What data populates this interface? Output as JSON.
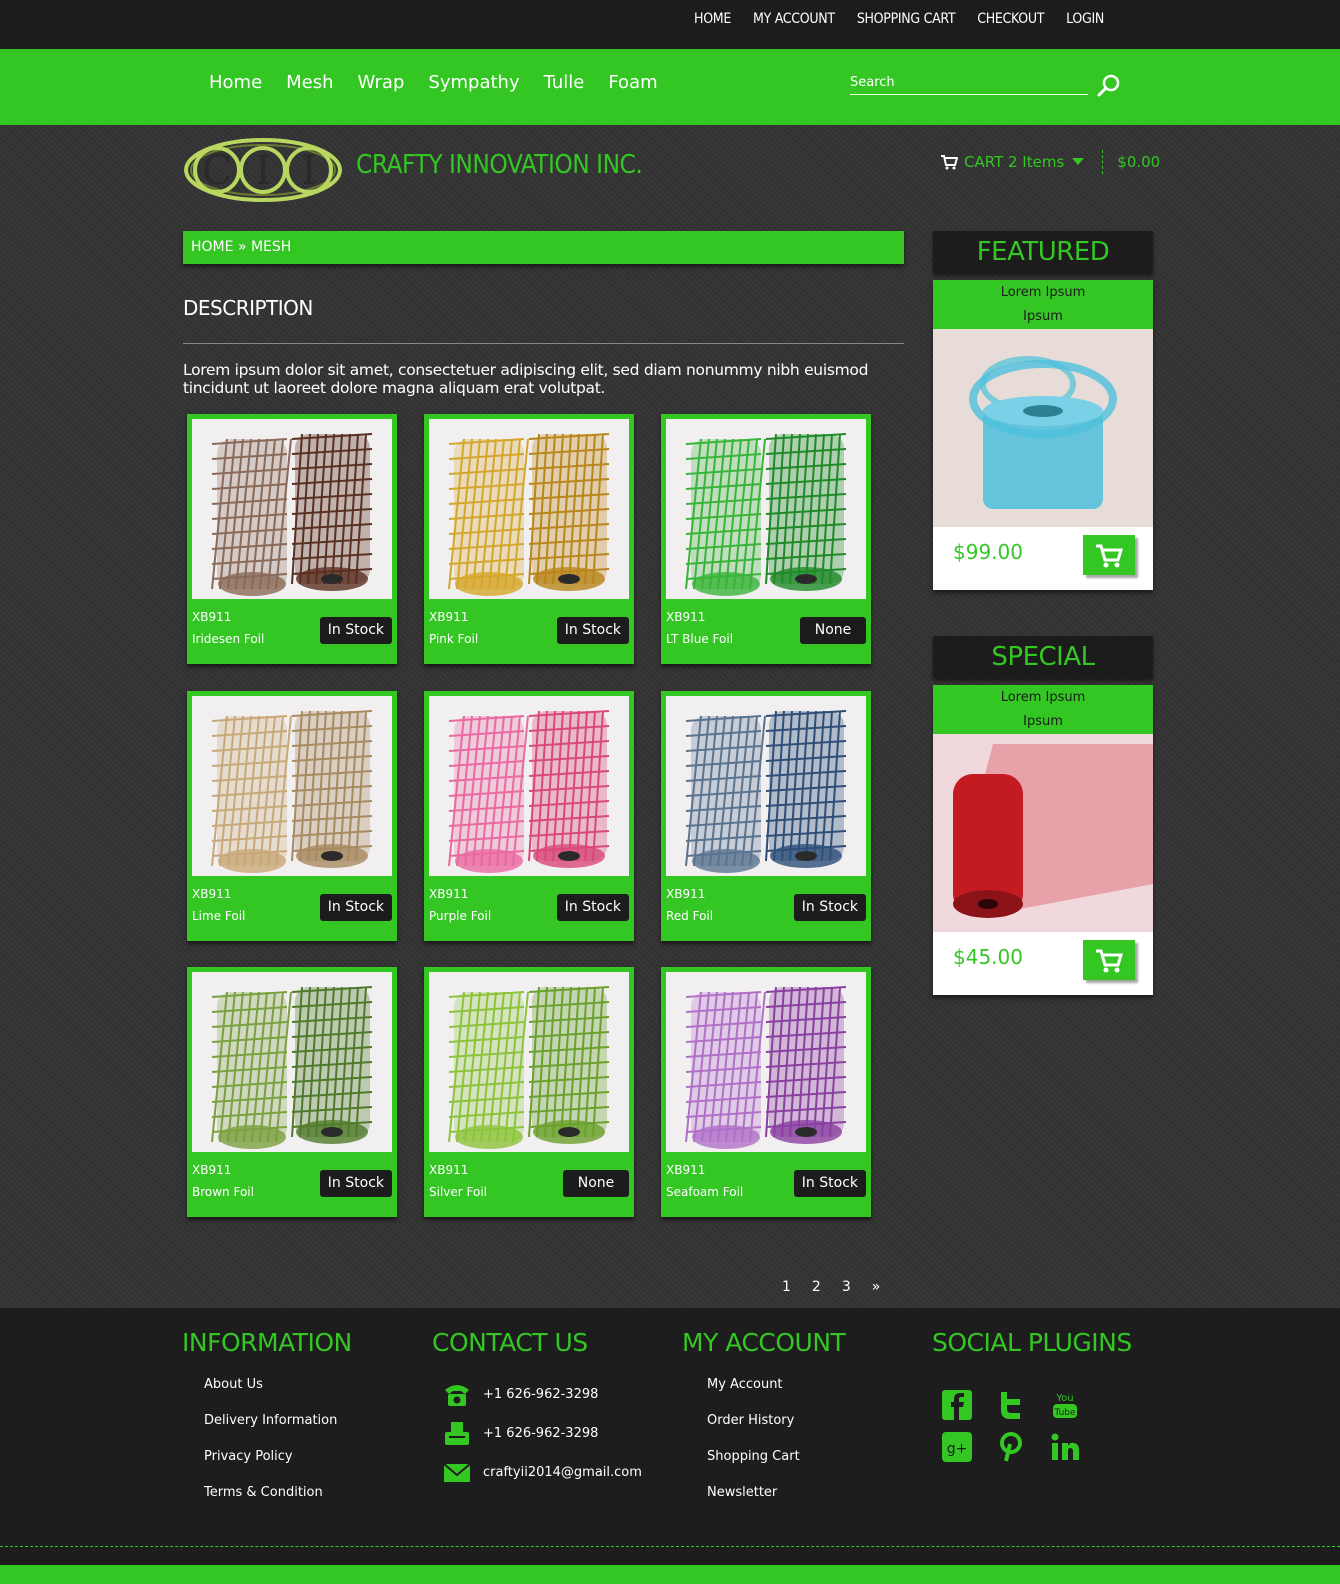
{
  "topbar": {
    "links": [
      "HOME",
      "MY ACCOUNT",
      "SHOPPING CART",
      "CHECKOUT",
      "LOGIN"
    ]
  },
  "nav": {
    "items": [
      "Home",
      "Mesh",
      "Wrap",
      "Sympathy",
      "Tulle",
      "Foam"
    ],
    "search_placeholder": "Search"
  },
  "header": {
    "brand": "CRAFTY INNOVATION INC.",
    "cart_label": "CART 2 Items",
    "cart_total": "$0.00",
    "logo_letters": "CII"
  },
  "breadcrumb": {
    "home": "HOME",
    "sep": "»",
    "current": "MESH"
  },
  "description": {
    "title": "DESCRIPTION",
    "text": "Lorem ipsum dolor sit amet, consectetuer adipiscing elit, sed diam nonummy nibh euismod tincidunt ut laoreet dolore magna aliquam erat volutpat."
  },
  "products": [
    {
      "sku": "XB911",
      "name": "Iridesen Foil",
      "stock": "In Stock",
      "colors": [
        "#8a6a58",
        "#5a3020"
      ]
    },
    {
      "sku": "XB911",
      "name": "Pink Foil",
      "stock": "In Stock",
      "colors": [
        "#d4a62a",
        "#b8861a"
      ]
    },
    {
      "sku": "XB911",
      "name": "LT Blue Foil",
      "stock": "None",
      "colors": [
        "#39b43a",
        "#1f8a28"
      ]
    },
    {
      "sku": "XB911",
      "name": "Lime Foil",
      "stock": "In Stock",
      "colors": [
        "#c8a878",
        "#a88a60"
      ]
    },
    {
      "sku": "XB911",
      "name": "Purple Foil",
      "stock": "In Stock",
      "colors": [
        "#ea6aa0",
        "#d84878"
      ]
    },
    {
      "sku": "XB911",
      "name": "Red Foil",
      "stock": "In Stock",
      "colors": [
        "#5a7490",
        "#2d4f78"
      ]
    },
    {
      "sku": "XB911",
      "name": "Brown Foil",
      "stock": "In Stock",
      "colors": [
        "#7aa040",
        "#4f7a2a"
      ]
    },
    {
      "sku": "XB911",
      "name": "Silver Foil",
      "stock": "None",
      "colors": [
        "#8cc43c",
        "#6aa02c"
      ]
    },
    {
      "sku": "XB911",
      "name": "Seafoam Foil",
      "stock": "In Stock",
      "colors": [
        "#b070c8",
        "#8a40a0"
      ]
    }
  ],
  "pagination": [
    "1",
    "2",
    "3",
    "»"
  ],
  "featured": {
    "heading": "FEATURED",
    "title_line1": "Lorem Ipsum",
    "title_line2": "Ipsum",
    "price": "$99.00",
    "color": "#4ec0dc"
  },
  "special": {
    "heading": "SPECIAL",
    "title_line1": "Lorem Ipsum",
    "title_line2": "Ipsum",
    "price": "$45.00",
    "color": "#c41a22"
  },
  "footer": {
    "information": {
      "heading": "INFORMATION",
      "links": [
        "About Us",
        "Delivery Information",
        "Privacy Policy",
        "Terms & Condition"
      ]
    },
    "contact": {
      "heading": "CONTACT US",
      "phone": "+1 626-962-3298",
      "fax": "+1 626-962-3298",
      "email": "craftyii2014@gmail.com"
    },
    "account": {
      "heading": "MY ACCOUNT",
      "links": [
        "My Account",
        "Order History",
        "Shopping Cart",
        "Newsletter"
      ]
    },
    "social": {
      "heading": "SOCIAL PLUGINS",
      "icons": [
        "facebook-icon",
        "twitter-icon",
        "youtube-icon",
        "google-plus-icon",
        "pinterest-icon",
        "linkedin-icon"
      ]
    }
  },
  "colors": {
    "accent": "#34c724",
    "dark": "#1c1c1c",
    "bg": "#333333"
  }
}
